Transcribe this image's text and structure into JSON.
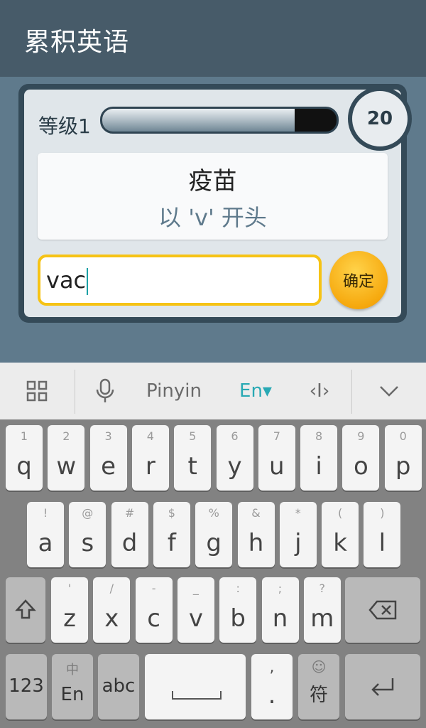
{
  "app": {
    "title": "累积英语"
  },
  "quiz": {
    "level_label": "等级1",
    "progress_fraction": 0.82,
    "score": "20",
    "word": "疫苗",
    "hint": "以 'v' 开头",
    "answer_value": "vac",
    "confirm_label": "确定"
  },
  "ime": {
    "pinyin_label": "Pinyin",
    "en_label": "En▾",
    "cursor_icon_text": "‹I›"
  },
  "keyboard": {
    "row1": [
      {
        "main": "q",
        "sub": "1"
      },
      {
        "main": "w",
        "sub": "2"
      },
      {
        "main": "e",
        "sub": "3"
      },
      {
        "main": "r",
        "sub": "4"
      },
      {
        "main": "t",
        "sub": "5"
      },
      {
        "main": "y",
        "sub": "6"
      },
      {
        "main": "u",
        "sub": "7"
      },
      {
        "main": "i",
        "sub": "8"
      },
      {
        "main": "o",
        "sub": "9"
      },
      {
        "main": "p",
        "sub": "0"
      }
    ],
    "row2": [
      {
        "main": "a",
        "sub": "!"
      },
      {
        "main": "s",
        "sub": "@"
      },
      {
        "main": "d",
        "sub": "#"
      },
      {
        "main": "f",
        "sub": "$"
      },
      {
        "main": "g",
        "sub": "%"
      },
      {
        "main": "h",
        "sub": "&"
      },
      {
        "main": "j",
        "sub": "*"
      },
      {
        "main": "k",
        "sub": "("
      },
      {
        "main": "l",
        "sub": ")"
      }
    ],
    "row3": [
      {
        "main": "z",
        "sub": "'"
      },
      {
        "main": "x",
        "sub": "/"
      },
      {
        "main": "c",
        "sub": "-"
      },
      {
        "main": "v",
        "sub": "_"
      },
      {
        "main": "b",
        "sub": ":"
      },
      {
        "main": "n",
        "sub": ";"
      },
      {
        "main": "m",
        "sub": "?"
      }
    ],
    "row4": {
      "num_label": "123",
      "lang_main": "En",
      "lang_sub": "中",
      "abc_label": "abc",
      "comma_sub": ",",
      "period_main": ".",
      "symbol_main": "符",
      "symbol_sub": "☺"
    }
  }
}
